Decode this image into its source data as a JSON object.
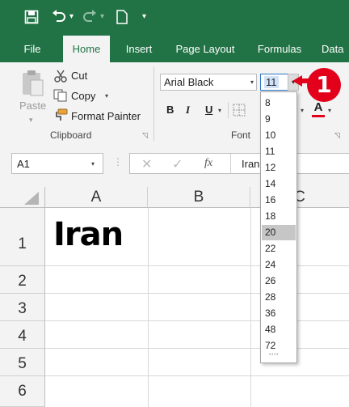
{
  "quick_access": {
    "save_icon": "save-icon",
    "undo_icon": "undo-icon",
    "redo_icon": "redo-icon",
    "new_icon": "new-document-icon"
  },
  "tabs": [
    {
      "label": "File"
    },
    {
      "label": "Home"
    },
    {
      "label": "Insert"
    },
    {
      "label": "Page Layout"
    },
    {
      "label": "Formulas"
    },
    {
      "label": "Data"
    }
  ],
  "clipboard": {
    "paste_label": "Paste",
    "cut_label": "Cut",
    "copy_label": "Copy",
    "format_painter_label": "Format Painter",
    "group_label": "Clipboard"
  },
  "font": {
    "font_name": "Arial Black",
    "font_size": "11",
    "bold": "B",
    "italic": "I",
    "underline": "U",
    "font_color_letter": "A",
    "group_label": "Font"
  },
  "formula_bar": {
    "name_box": "A1",
    "cancel": "✕",
    "enter": "✓",
    "fx": "fx",
    "value": "Iran"
  },
  "columns": [
    "A",
    "B",
    "C"
  ],
  "rows": [
    "1",
    "2",
    "3",
    "4",
    "5",
    "6"
  ],
  "cells": {
    "A1": "Iran"
  },
  "size_dropdown": {
    "options": [
      "8",
      "9",
      "10",
      "11",
      "12",
      "14",
      "16",
      "18",
      "20",
      "22",
      "24",
      "26",
      "28",
      "36",
      "48",
      "72"
    ],
    "highlighted": "20",
    "more": "••••"
  },
  "callout": {
    "number": "1"
  },
  "colors": {
    "brand_green": "#217346",
    "callout_red": "#e2001a",
    "highlight": "#c6c6c6"
  }
}
